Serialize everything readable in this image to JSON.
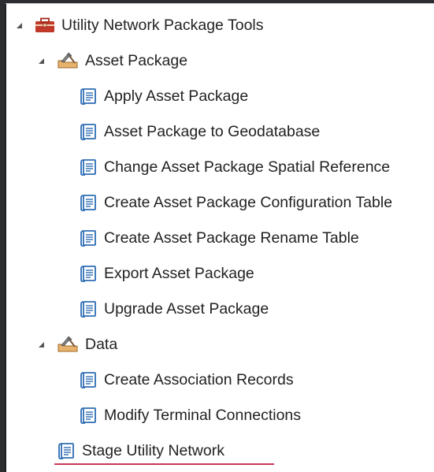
{
  "tree": {
    "root": {
      "label": "Utility Network Package Tools",
      "icon": "toolbox-icon",
      "expanded": true
    },
    "asset_package": {
      "label": "Asset Package",
      "icon": "toolset-icon",
      "expanded": true,
      "tools": [
        {
          "label": "Apply Asset Package",
          "icon": "script-tool-icon"
        },
        {
          "label": "Asset Package to Geodatabase",
          "icon": "script-tool-icon"
        },
        {
          "label": "Change Asset Package Spatial Reference",
          "icon": "script-tool-icon"
        },
        {
          "label": "Create Asset Package Configuration Table",
          "icon": "script-tool-icon"
        },
        {
          "label": "Create Asset Package Rename Table",
          "icon": "script-tool-icon"
        },
        {
          "label": "Export Asset Package",
          "icon": "script-tool-icon"
        },
        {
          "label": "Upgrade Asset Package",
          "icon": "script-tool-icon"
        }
      ]
    },
    "data": {
      "label": "Data",
      "icon": "toolset-icon",
      "expanded": true,
      "tools": [
        {
          "label": "Create Association Records",
          "icon": "script-tool-icon"
        },
        {
          "label": "Modify Terminal Connections",
          "icon": "script-tool-icon"
        }
      ]
    },
    "root_tools": [
      {
        "label": "Stage Utility Network",
        "icon": "script-tool-icon",
        "highlighted": true
      }
    ]
  },
  "colors": {
    "highlight_underline": "#c8375a",
    "script_icon": "#2e6db4",
    "toolbox_icon": "#c0392b"
  }
}
